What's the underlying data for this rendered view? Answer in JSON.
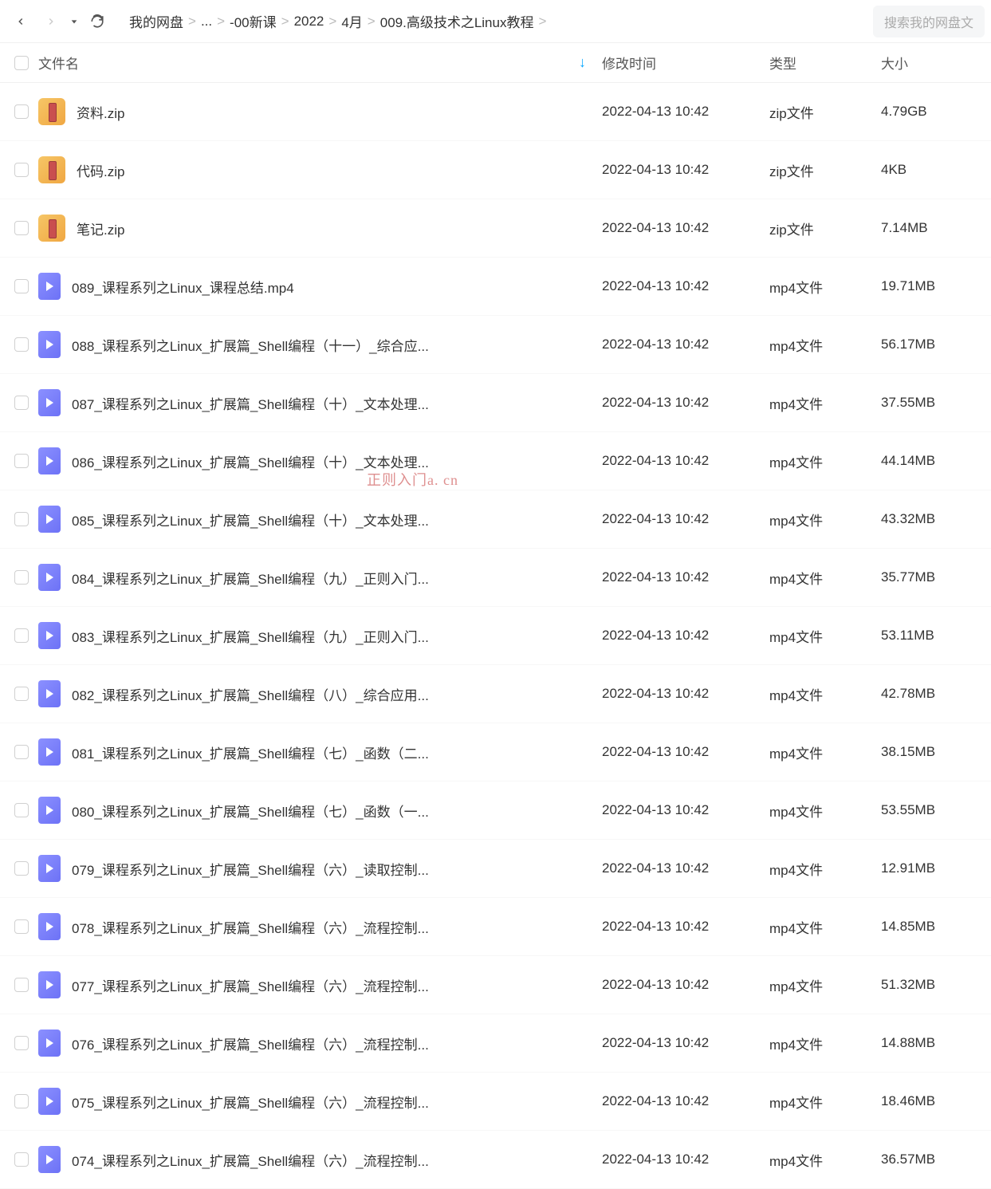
{
  "nav": {
    "back_label": "back",
    "forward_label": "forward",
    "dropdown_label": "history",
    "refresh_label": "refresh"
  },
  "breadcrumb": [
    "我的网盘",
    "...",
    "-00新课",
    "2022",
    "4月",
    "009.高级技术之Linux教程"
  ],
  "search_placeholder": "搜索我的网盘文",
  "columns": {
    "name": "文件名",
    "date": "修改时间",
    "type": "类型",
    "size": "大小"
  },
  "watermark": "正则入门a. cn",
  "files": [
    {
      "name": "资料.zip",
      "date": "2022-04-13 10:42",
      "type": "zip文件",
      "size": "4.79GB",
      "icon": "zip"
    },
    {
      "name": "代码.zip",
      "date": "2022-04-13 10:42",
      "type": "zip文件",
      "size": "4KB",
      "icon": "zip"
    },
    {
      "name": "笔记.zip",
      "date": "2022-04-13 10:42",
      "type": "zip文件",
      "size": "7.14MB",
      "icon": "zip"
    },
    {
      "name": "089_课程系列之Linux_课程总结.mp4",
      "date": "2022-04-13 10:42",
      "type": "mp4文件",
      "size": "19.71MB",
      "icon": "mp4"
    },
    {
      "name": "088_课程系列之Linux_扩展篇_Shell编程（十一）_综合应...",
      "date": "2022-04-13 10:42",
      "type": "mp4文件",
      "size": "56.17MB",
      "icon": "mp4"
    },
    {
      "name": "087_课程系列之Linux_扩展篇_Shell编程（十）_文本处理...",
      "date": "2022-04-13 10:42",
      "type": "mp4文件",
      "size": "37.55MB",
      "icon": "mp4"
    },
    {
      "name": "086_课程系列之Linux_扩展篇_Shell编程（十）_文本处理...",
      "date": "2022-04-13 10:42",
      "type": "mp4文件",
      "size": "44.14MB",
      "icon": "mp4"
    },
    {
      "name": "085_课程系列之Linux_扩展篇_Shell编程（十）_文本处理...",
      "date": "2022-04-13 10:42",
      "type": "mp4文件",
      "size": "43.32MB",
      "icon": "mp4"
    },
    {
      "name": "084_课程系列之Linux_扩展篇_Shell编程（九）_正则入门...",
      "date": "2022-04-13 10:42",
      "type": "mp4文件",
      "size": "35.77MB",
      "icon": "mp4"
    },
    {
      "name": "083_课程系列之Linux_扩展篇_Shell编程（九）_正则入门...",
      "date": "2022-04-13 10:42",
      "type": "mp4文件",
      "size": "53.11MB",
      "icon": "mp4"
    },
    {
      "name": "082_课程系列之Linux_扩展篇_Shell编程（八）_综合应用...",
      "date": "2022-04-13 10:42",
      "type": "mp4文件",
      "size": "42.78MB",
      "icon": "mp4"
    },
    {
      "name": "081_课程系列之Linux_扩展篇_Shell编程（七）_函数（二...",
      "date": "2022-04-13 10:42",
      "type": "mp4文件",
      "size": "38.15MB",
      "icon": "mp4"
    },
    {
      "name": "080_课程系列之Linux_扩展篇_Shell编程（七）_函数（一...",
      "date": "2022-04-13 10:42",
      "type": "mp4文件",
      "size": "53.55MB",
      "icon": "mp4"
    },
    {
      "name": "079_课程系列之Linux_扩展篇_Shell编程（六）_读取控制...",
      "date": "2022-04-13 10:42",
      "type": "mp4文件",
      "size": "12.91MB",
      "icon": "mp4"
    },
    {
      "name": "078_课程系列之Linux_扩展篇_Shell编程（六）_流程控制...",
      "date": "2022-04-13 10:42",
      "type": "mp4文件",
      "size": "14.85MB",
      "icon": "mp4"
    },
    {
      "name": "077_课程系列之Linux_扩展篇_Shell编程（六）_流程控制...",
      "date": "2022-04-13 10:42",
      "type": "mp4文件",
      "size": "51.32MB",
      "icon": "mp4"
    },
    {
      "name": "076_课程系列之Linux_扩展篇_Shell编程（六）_流程控制...",
      "date": "2022-04-13 10:42",
      "type": "mp4文件",
      "size": "14.88MB",
      "icon": "mp4"
    },
    {
      "name": "075_课程系列之Linux_扩展篇_Shell编程（六）_流程控制...",
      "date": "2022-04-13 10:42",
      "type": "mp4文件",
      "size": "18.46MB",
      "icon": "mp4"
    },
    {
      "name": "074_课程系列之Linux_扩展篇_Shell编程（六）_流程控制...",
      "date": "2022-04-13 10:42",
      "type": "mp4文件",
      "size": "36.57MB",
      "icon": "mp4"
    }
  ]
}
